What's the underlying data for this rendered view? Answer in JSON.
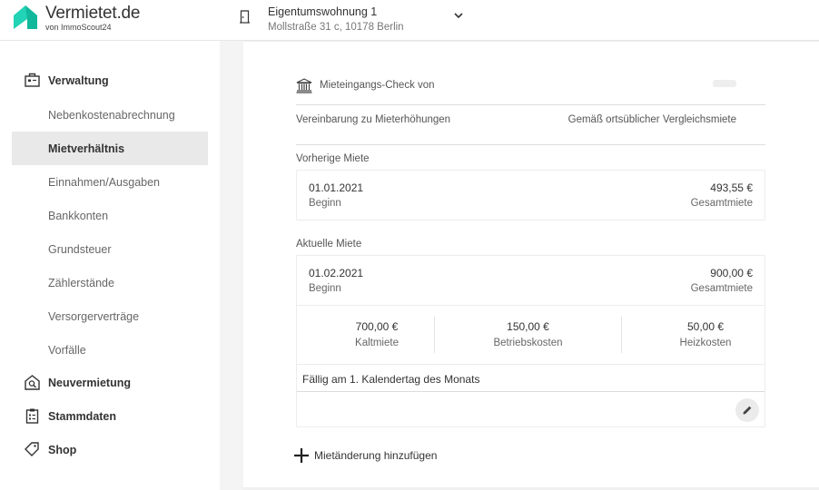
{
  "header": {
    "logo_name": "Vermietet.de",
    "logo_sub": "von ImmoScout24",
    "property_title": "Eigentumswohnung 1",
    "property_address": "Mollstraße 31 c, 10178 Berlin"
  },
  "sidebar": {
    "groups": [
      {
        "label": "Verwaltung",
        "icon": "briefcase-icon"
      },
      {
        "label": "Neuvermietung",
        "icon": "house-search-icon"
      },
      {
        "label": "Stammdaten",
        "icon": "clipboard-icon"
      },
      {
        "label": "Shop",
        "icon": "tag-icon"
      }
    ],
    "items": [
      {
        "label": "Nebenkostenabrechnung"
      },
      {
        "label": "Mietverhältnis",
        "active": true
      },
      {
        "label": "Einnahmen/Ausgaben"
      },
      {
        "label": "Bankkonten"
      },
      {
        "label": "Grundsteuer"
      },
      {
        "label": "Zählerstände"
      },
      {
        "label": "Versorgerverträge"
      },
      {
        "label": "Vorfälle"
      }
    ]
  },
  "main": {
    "check_label": "Mieteingangs-Check von",
    "agreement_label": "Vereinbarung zu Mieterhöhungen",
    "agreement_value": "Gemäß ortsüblicher Vergleichsmiete",
    "previous": {
      "section": "Vorherige Miete",
      "date": "01.01.2021",
      "date_label": "Beginn",
      "amount": "493,55 €",
      "amount_label": "Gesamtmiete"
    },
    "current": {
      "section": "Aktuelle Miete",
      "date": "01.02.2021",
      "date_label": "Beginn",
      "amount": "900,00 €",
      "amount_label": "Gesamtmiete",
      "breakdown": [
        {
          "value": "700,00 €",
          "label": "Kaltmiete"
        },
        {
          "value": "150,00 €",
          "label": "Betriebskosten"
        },
        {
          "value": "50,00 €",
          "label": "Heizkosten"
        }
      ],
      "due": "Fällig am 1. Kalendertag des Monats"
    },
    "add_label": "Mietänderung hinzufügen"
  },
  "colors": {
    "brand": "#22d3b5",
    "active_bg": "#e9e9e9"
  }
}
